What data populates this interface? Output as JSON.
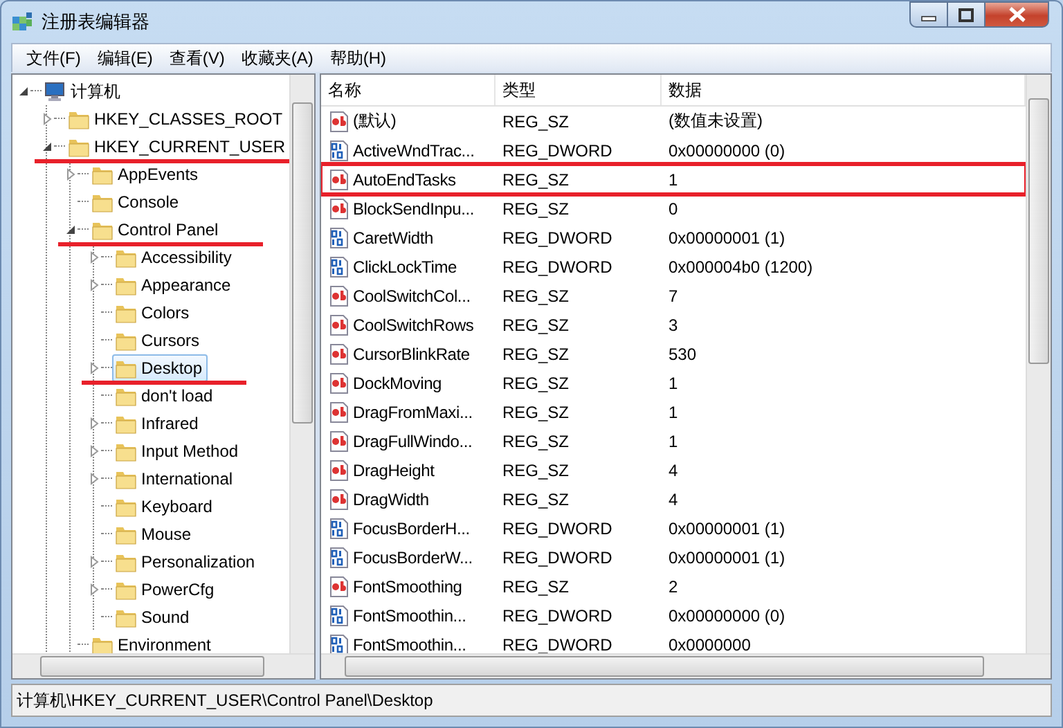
{
  "window": {
    "title": "注册表编辑器"
  },
  "menu": [
    "文件(F)",
    "编辑(E)",
    "查看(V)",
    "收藏夹(A)",
    "帮助(H)"
  ],
  "tree": [
    {
      "label": "计算机",
      "kind": "computer",
      "expanded": true,
      "selected": false,
      "marked": false,
      "children": [
        {
          "label": "HKEY_CLASSES_ROOT",
          "kind": "branch",
          "expanded": false,
          "selected": false,
          "marked": false
        },
        {
          "label": "HKEY_CURRENT_USER",
          "kind": "branch",
          "expanded": true,
          "selected": false,
          "marked": true,
          "children": [
            {
              "label": "AppEvents",
              "kind": "branch",
              "expanded": false,
              "selected": false,
              "marked": false
            },
            {
              "label": "Console",
              "kind": "leaf",
              "selected": false,
              "marked": false
            },
            {
              "label": "Control Panel",
              "kind": "branch",
              "expanded": true,
              "selected": false,
              "marked": true,
              "children": [
                {
                  "label": "Accessibility",
                  "kind": "branch",
                  "expanded": false,
                  "selected": false,
                  "marked": false
                },
                {
                  "label": "Appearance",
                  "kind": "branch",
                  "expanded": false,
                  "selected": false,
                  "marked": false
                },
                {
                  "label": "Colors",
                  "kind": "leaf",
                  "selected": false,
                  "marked": false
                },
                {
                  "label": "Cursors",
                  "kind": "leaf",
                  "selected": false,
                  "marked": false
                },
                {
                  "label": "Desktop",
                  "kind": "branch",
                  "expanded": false,
                  "selected": true,
                  "marked": true
                },
                {
                  "label": "don't load",
                  "kind": "leaf",
                  "selected": false,
                  "marked": false
                },
                {
                  "label": "Infrared",
                  "kind": "branch",
                  "expanded": false,
                  "selected": false,
                  "marked": false
                },
                {
                  "label": "Input Method",
                  "kind": "branch",
                  "expanded": false,
                  "selected": false,
                  "marked": false
                },
                {
                  "label": "International",
                  "kind": "branch",
                  "expanded": false,
                  "selected": false,
                  "marked": false
                },
                {
                  "label": "Keyboard",
                  "kind": "leaf",
                  "selected": false,
                  "marked": false
                },
                {
                  "label": "Mouse",
                  "kind": "leaf",
                  "selected": false,
                  "marked": false
                },
                {
                  "label": "Personalization",
                  "kind": "branch",
                  "expanded": false,
                  "selected": false,
                  "marked": false
                },
                {
                  "label": "PowerCfg",
                  "kind": "branch",
                  "expanded": false,
                  "selected": false,
                  "marked": false
                },
                {
                  "label": "Sound",
                  "kind": "leaf",
                  "selected": false,
                  "marked": false
                }
              ]
            },
            {
              "label": "Environment",
              "kind": "leaf",
              "selected": false,
              "marked": false
            }
          ]
        }
      ]
    }
  ],
  "list": {
    "columns": [
      "名称",
      "类型",
      "数据"
    ],
    "rows": [
      {
        "kind": "string",
        "name": "(默认)",
        "type": "REG_SZ",
        "data": "(数值未设置)",
        "marked": false
      },
      {
        "kind": "dword",
        "name": "ActiveWndTrac...",
        "type": "REG_DWORD",
        "data": "0x00000000 (0)",
        "marked": false
      },
      {
        "kind": "string",
        "name": "AutoEndTasks",
        "type": "REG_SZ",
        "data": "1",
        "marked": true
      },
      {
        "kind": "string",
        "name": "BlockSendInpu...",
        "type": "REG_SZ",
        "data": "0",
        "marked": false
      },
      {
        "kind": "dword",
        "name": "CaretWidth",
        "type": "REG_DWORD",
        "data": "0x00000001 (1)",
        "marked": false
      },
      {
        "kind": "dword",
        "name": "ClickLockTime",
        "type": "REG_DWORD",
        "data": "0x000004b0 (1200)",
        "marked": false
      },
      {
        "kind": "string",
        "name": "CoolSwitchCol...",
        "type": "REG_SZ",
        "data": "7",
        "marked": false
      },
      {
        "kind": "string",
        "name": "CoolSwitchRows",
        "type": "REG_SZ",
        "data": "3",
        "marked": false
      },
      {
        "kind": "string",
        "name": "CursorBlinkRate",
        "type": "REG_SZ",
        "data": "530",
        "marked": false
      },
      {
        "kind": "string",
        "name": "DockMoving",
        "type": "REG_SZ",
        "data": "1",
        "marked": false
      },
      {
        "kind": "string",
        "name": "DragFromMaxi...",
        "type": "REG_SZ",
        "data": "1",
        "marked": false
      },
      {
        "kind": "string",
        "name": "DragFullWindo...",
        "type": "REG_SZ",
        "data": "1",
        "marked": false
      },
      {
        "kind": "string",
        "name": "DragHeight",
        "type": "REG_SZ",
        "data": "4",
        "marked": false
      },
      {
        "kind": "string",
        "name": "DragWidth",
        "type": "REG_SZ",
        "data": "4",
        "marked": false
      },
      {
        "kind": "dword",
        "name": "FocusBorderH...",
        "type": "REG_DWORD",
        "data": "0x00000001 (1)",
        "marked": false
      },
      {
        "kind": "dword",
        "name": "FocusBorderW...",
        "type": "REG_DWORD",
        "data": "0x00000001 (1)",
        "marked": false
      },
      {
        "kind": "string",
        "name": "FontSmoothing",
        "type": "REG_SZ",
        "data": "2",
        "marked": false
      },
      {
        "kind": "dword",
        "name": "FontSmoothin...",
        "type": "REG_DWORD",
        "data": "0x00000000 (0)",
        "marked": false
      },
      {
        "kind": "dword",
        "name": "FontSmoothin...",
        "type": "REG_DWORD",
        "data": "0x0000000",
        "marked": false
      }
    ]
  },
  "status_bar": "计算机\\HKEY_CURRENT_USER\\Control Panel\\Desktop"
}
